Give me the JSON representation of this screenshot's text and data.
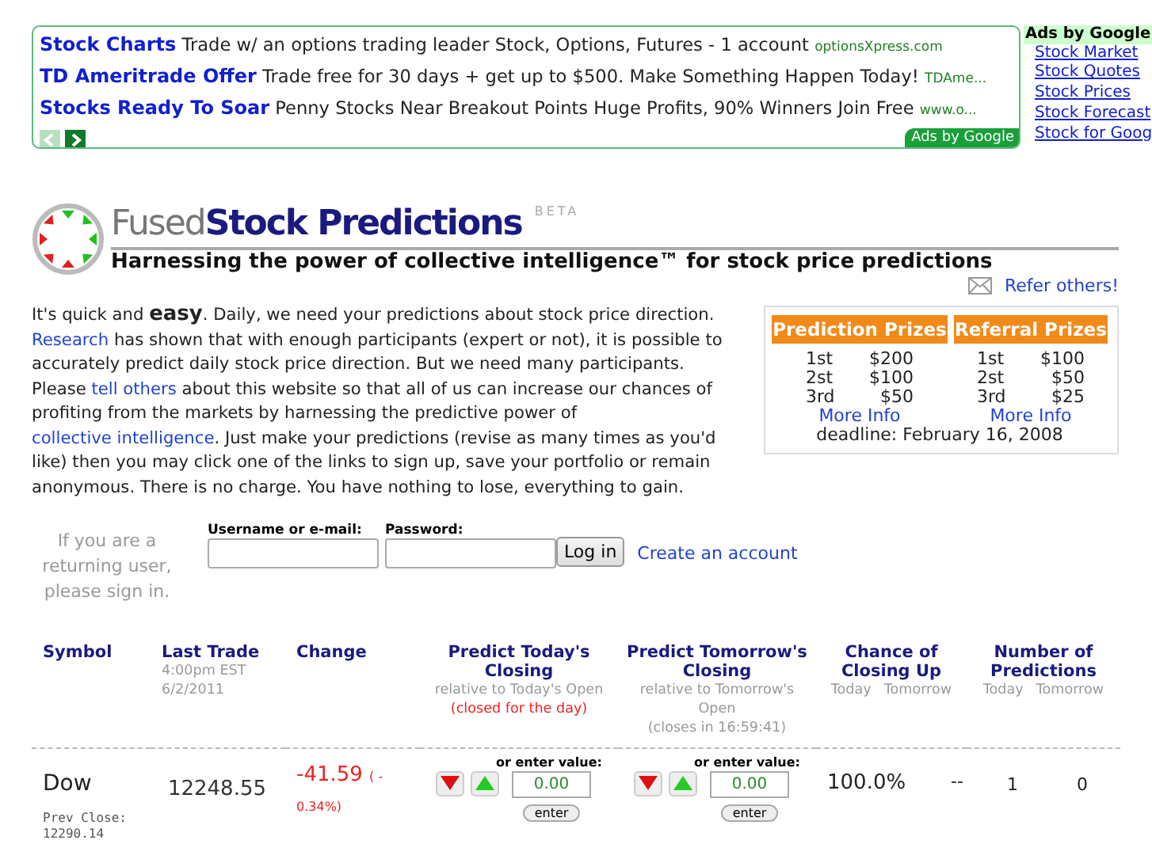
{
  "ads": {
    "items": [
      {
        "title": "Stock Charts",
        "text": "Trade w/ an options trading leader Stock, Options, Futures - 1 account",
        "url": "optionsXpress.com"
      },
      {
        "title": "TD Ameritrade Offer",
        "text": "Trade free for 30 days + get up to $500. Make Something Happen Today!",
        "url": "TDAme..."
      },
      {
        "title": "Stocks Ready To Soar",
        "text": "Penny Stocks Near Breakout Points Huge Profits, 90% Winners Join Free",
        "url": "www.o..."
      }
    ],
    "prev_disabled": true,
    "next_disabled": false,
    "badge": "Ads by Google"
  },
  "side_ads": {
    "heading": "Ads by Google",
    "links": [
      "Stock Market",
      "Stock Quotes",
      "Stock Prices",
      "Stock Forecast",
      "Stock for Goog"
    ]
  },
  "logo": {
    "light": "Fused",
    "bold": "Stock Predictions",
    "badge": "BETA"
  },
  "tagline": "Harnessing the power of collective intelligence™ for stock price predictions",
  "refer_link": "Refer others!",
  "intro": [
    {
      "kind": "text",
      "text": "It's quick and "
    },
    {
      "kind": "bold",
      "text": "easy"
    },
    {
      "kind": "text",
      "text": ".  Daily, we need your predictions about stock price direction.  "
    },
    {
      "kind": "link",
      "text": "Research"
    },
    {
      "kind": "text",
      "text": " has shown that with enough participants (expert or not), it is possible to accurately predict daily stock price direction.  But we need many participants.  Please "
    },
    {
      "kind": "link",
      "text": "tell others"
    },
    {
      "kind": "text",
      "text": " about this website so that all of us can increase our chances of profiting from the markets by harnessing the predictive power of "
    },
    {
      "kind": "link",
      "text": "collective intelligence"
    },
    {
      "kind": "text",
      "text": ".  Just make your predictions (revise as many times as you'd like) then you may click one of the links to sign up, save your portfolio or remain anonymous. There is no charge.  You have nothing to lose, everything to gain."
    }
  ],
  "prizes": {
    "columns": [
      {
        "heading": "Prediction Prizes",
        "rows": [
          {
            "place": "1st",
            "amount": "$200"
          },
          {
            "place": "2st",
            "amount": "$100"
          },
          {
            "place": "3rd",
            "amount": "$50"
          }
        ],
        "link": "More Info"
      },
      {
        "heading": "Referral Prizes",
        "rows": [
          {
            "place": "1st",
            "amount": "$100"
          },
          {
            "place": "2st",
            "amount": "$50"
          },
          {
            "place": "3rd",
            "amount": "$25"
          }
        ],
        "link": "More Info"
      }
    ],
    "deadline": "deadline: February 16, 2008"
  },
  "login": {
    "prompt": "If you are a returning user, please sign in.",
    "username_label": "Username or e-mail:",
    "password_label": "Password:",
    "button": "Log in",
    "create_link": "Create an account"
  },
  "table": {
    "columns": [
      {
        "title": "Symbol"
      },
      {
        "title": "Last Trade",
        "notes": [
          {
            "kind": "note",
            "text": "4:00pm EST"
          },
          {
            "kind": "note",
            "text": "6/2/2011"
          }
        ]
      },
      {
        "title": "Change"
      },
      {
        "title": "Predict Today's Closing",
        "notes": [
          {
            "kind": "note",
            "text": "relative to Today's Open"
          },
          {
            "kind": "alert",
            "text": "(closed for the day)"
          }
        ]
      },
      {
        "title": "Predict Tomorrow's Closing",
        "notes": [
          {
            "kind": "note",
            "text": "relative to Tomorrow's Open"
          },
          {
            "kind": "note",
            "text": "(closes in 16:59:41)"
          }
        ]
      },
      {
        "title": "Chance of Closing Up",
        "notes": [
          {
            "kind": "split",
            "text": "Today"
          },
          {
            "kind": "split",
            "text": "Tomorrow"
          }
        ]
      },
      {
        "title": "Number of Predictions",
        "notes": [
          {
            "kind": "split",
            "text": "Today"
          },
          {
            "kind": "split",
            "text": "Tomorrow"
          }
        ]
      }
    ],
    "rows": [
      {
        "symbol": "Dow",
        "prev_close_label": "Prev Close:",
        "prev_close": "12290.14",
        "last_trade": "12248.55",
        "change": "-41.59",
        "change_pct": "( - 0.34%)",
        "predictions": [
          {
            "label": "or enter value:",
            "value": "0.00",
            "button": "enter"
          },
          {
            "label": "or enter value:",
            "value": "0.00",
            "button": "enter"
          }
        ],
        "chance_today": "100.0%",
        "chance_tomorrow": "--",
        "count_today": "1",
        "count_tomorrow": "0"
      }
    ]
  }
}
